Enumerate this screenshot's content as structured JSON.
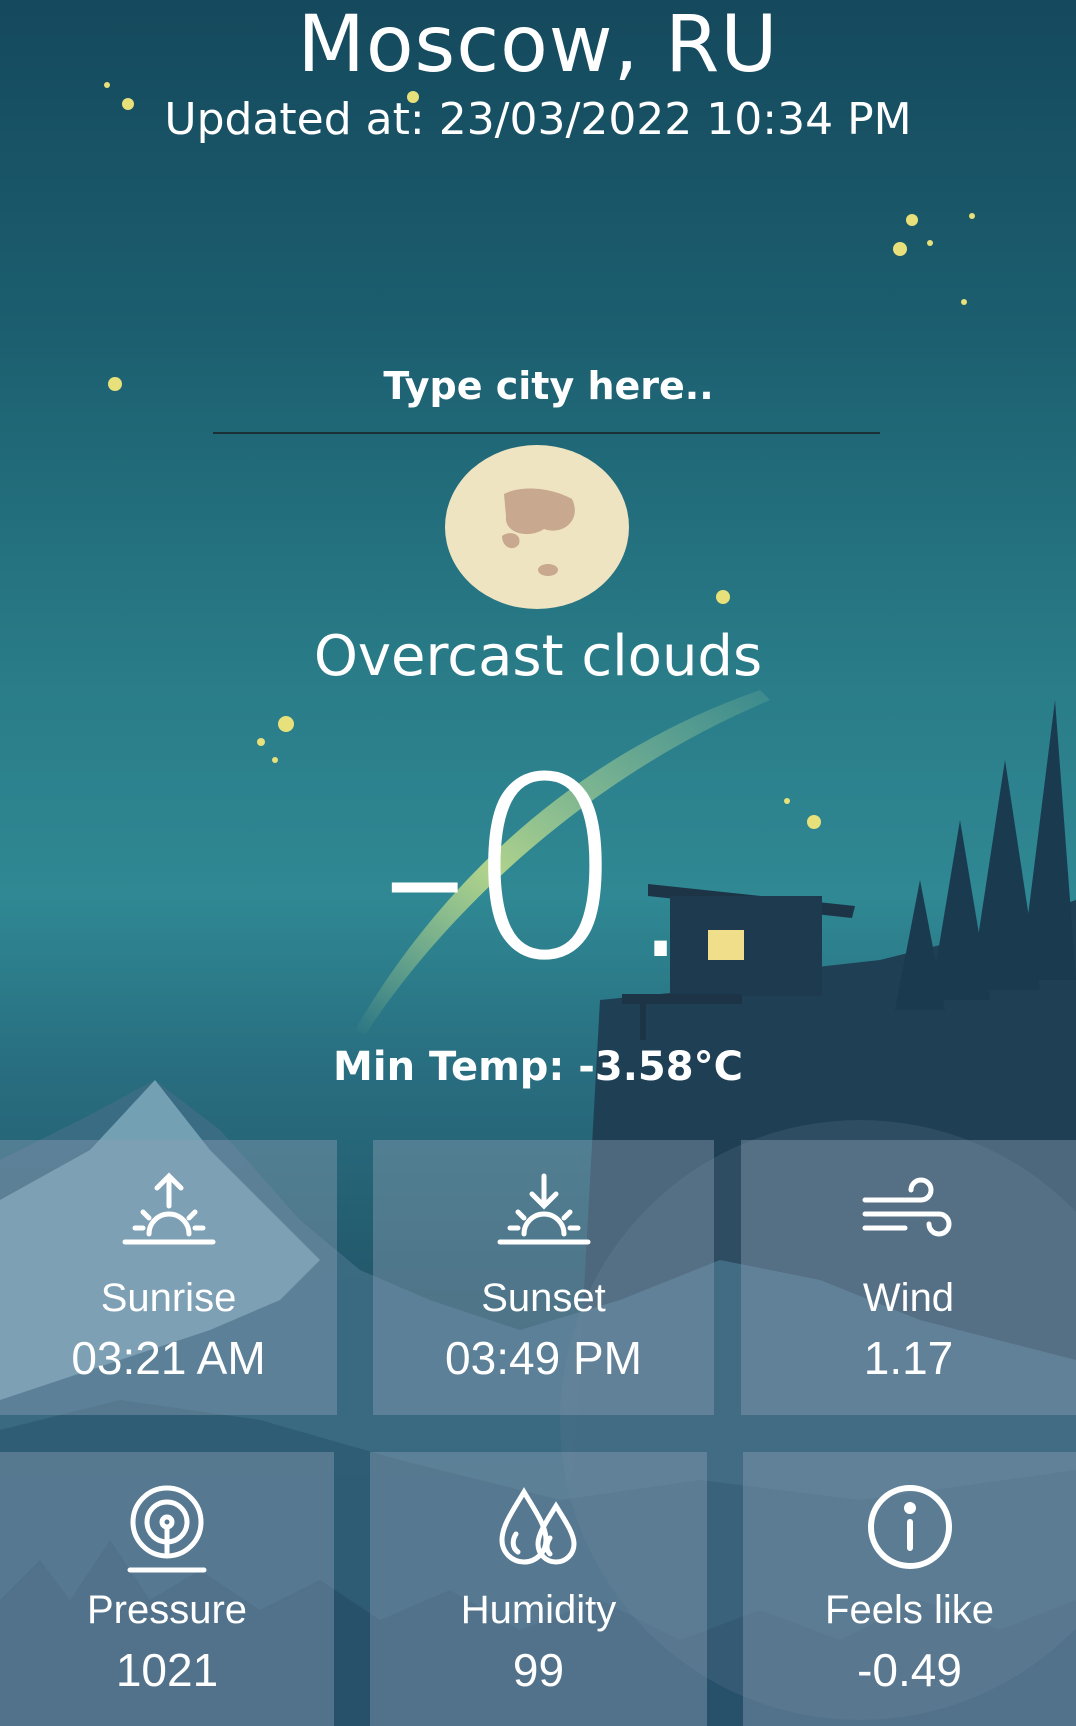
{
  "header": {
    "city": "Moscow, RU",
    "updated": "Updated at: 23/03/2022 10:34 PM"
  },
  "search": {
    "placeholder": "Type city here.."
  },
  "weather": {
    "icon": "moon-icon",
    "description": "Overcast clouds",
    "temperature": "-0.",
    "min_temp": "Min Temp: -3.58°C"
  },
  "details": [
    {
      "icon": "sunrise-icon",
      "label": "Sunrise",
      "value": "03:21 AM"
    },
    {
      "icon": "sunset-icon",
      "label": "Sunset",
      "value": "03:49 PM"
    },
    {
      "icon": "wind-icon",
      "label": "Wind",
      "value": "1.17"
    },
    {
      "icon": "pressure-icon",
      "label": "Pressure",
      "value": "1021"
    },
    {
      "icon": "humidity-icon",
      "label": "Humidity",
      "value": "99"
    },
    {
      "icon": "info-icon",
      "label": "Feels like",
      "value": "-0.49"
    }
  ],
  "colors": {
    "sky_top": "#15495d",
    "sky_mid": "#2f8893",
    "moon": "#efe4c1",
    "star": "#e8e07a",
    "tile": "#8ca0b4"
  }
}
